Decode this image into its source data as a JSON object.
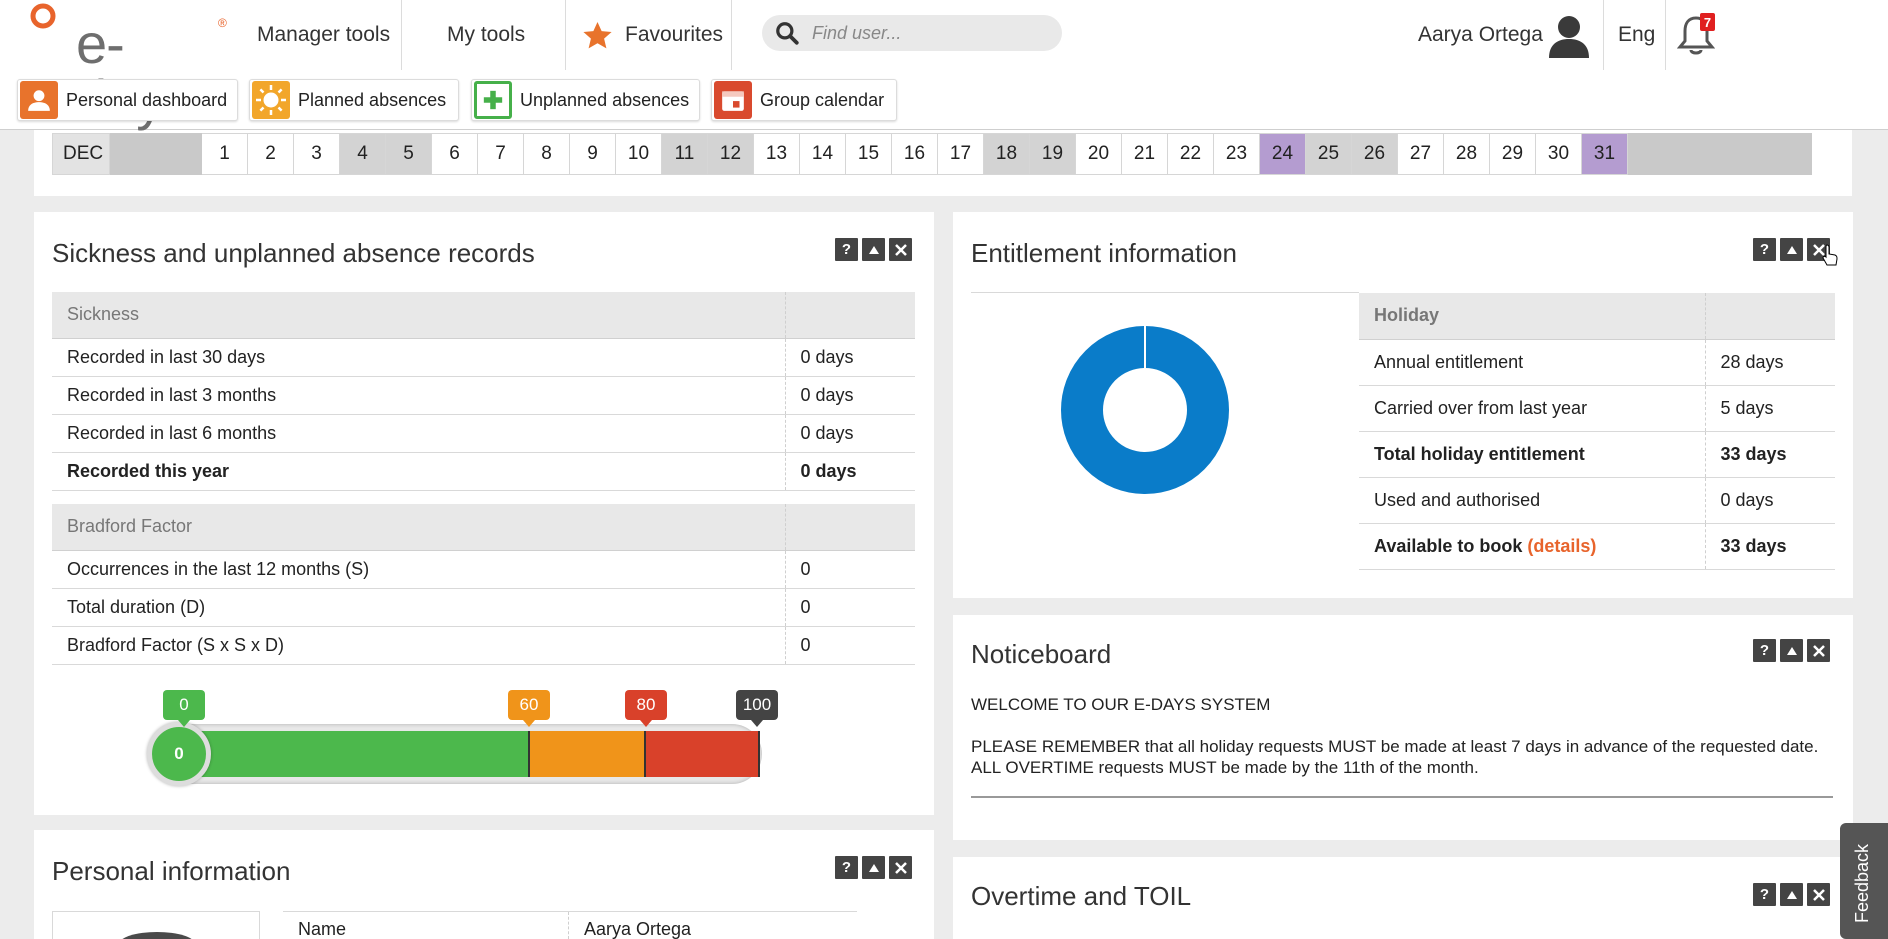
{
  "header": {
    "logo_text": "e-days",
    "logo_mark": "®",
    "nav": [
      "Manager tools",
      "My tools",
      "Favourites"
    ],
    "search_placeholder": "Find user...",
    "user_name": "Aarya Ortega",
    "language": "Eng",
    "notification_count": "7"
  },
  "quick_actions": [
    {
      "label": "Personal dashboard",
      "icon": "person-icon",
      "color": "#e8732c"
    },
    {
      "label": "Planned absences",
      "icon": "sun-icon",
      "color": "#f2a62a"
    },
    {
      "label": "Unplanned absences",
      "icon": "plus-icon",
      "color": "#46b04a"
    },
    {
      "label": "Group calendar",
      "icon": "calendar-icon",
      "color": "#d94a2e"
    }
  ],
  "calendar": {
    "month": "DEC",
    "days": [
      "1",
      "2",
      "3",
      "4",
      "5",
      "6",
      "7",
      "8",
      "9",
      "10",
      "11",
      "12",
      "13",
      "14",
      "15",
      "16",
      "17",
      "18",
      "19",
      "20",
      "21",
      "22",
      "23",
      "24",
      "25",
      "26",
      "27",
      "28",
      "29",
      "30",
      "31"
    ],
    "weekend_days": [
      "4",
      "5",
      "11",
      "12",
      "18",
      "19",
      "25",
      "26"
    ],
    "holiday_days": [
      "24",
      "31"
    ]
  },
  "sickness_panel": {
    "title": "Sickness and unplanned absence records",
    "sickness_header": "Sickness",
    "sickness_rows": [
      {
        "label": "Recorded in last 30 days",
        "value": "0 days"
      },
      {
        "label": "Recorded in last 3 months",
        "value": "0 days"
      },
      {
        "label": "Recorded in last 6 months",
        "value": "0 days"
      },
      {
        "label": "Recorded this year",
        "value": "0 days"
      }
    ],
    "bradford_header": "Bradford Factor",
    "bradford_rows": [
      {
        "label": "Occurrences in the last 12 months (S)",
        "value": "0"
      },
      {
        "label": "Total duration (D)",
        "value": "0"
      },
      {
        "label": "Bradford Factor (S x S x D)",
        "value": "0"
      }
    ],
    "gauge": {
      "current": "0",
      "markers": [
        "0",
        "60",
        "80",
        "100"
      ],
      "colors": {
        "green": "#4cb84c",
        "orange": "#f0941a",
        "red": "#d9412a",
        "dark": "#444444"
      }
    }
  },
  "entitlement_panel": {
    "title": "Entitlement information",
    "header": "Holiday",
    "rows": [
      {
        "label": "Annual entitlement",
        "value": "28 days"
      },
      {
        "label": "Carried over from last year",
        "value": "5 days"
      },
      {
        "label": "Total holiday entitlement",
        "value": "33 days"
      },
      {
        "label": "Used and authorised",
        "value": "0 days"
      },
      {
        "label": "Available to book",
        "link": "(details)",
        "value": "33 days"
      }
    ],
    "donut_color": "#0a7cc9"
  },
  "noticeboard": {
    "title": "Noticeboard",
    "line1": "WELCOME TO OUR E-DAYS SYSTEM",
    "line2": "PLEASE REMEMBER that all holiday requests MUST be made at least 7 days in advance of the requested date. ALL OVERTIME requests MUST be made by the 11th of the month."
  },
  "personal_panel": {
    "title": "Personal information",
    "name_label": "Name",
    "name_value": "Aarya Ortega"
  },
  "overtime_panel": {
    "title": "Overtime and TOIL"
  },
  "feedback_label": "Feedback",
  "panel_controls": {
    "help": "?"
  }
}
